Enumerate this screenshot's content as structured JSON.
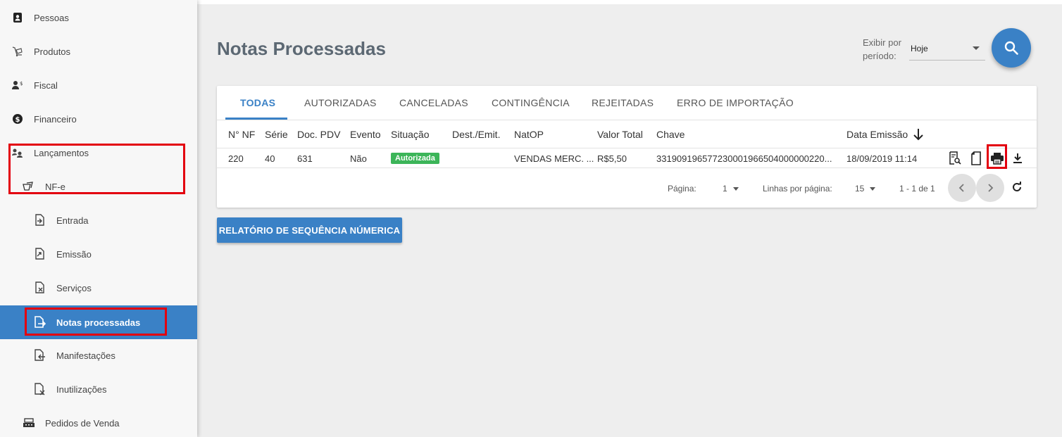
{
  "sidebar": {
    "items": [
      {
        "label": "Pessoas",
        "icon": "contacts-icon"
      },
      {
        "label": "Produtos",
        "icon": "products-icon"
      },
      {
        "label": "Fiscal",
        "icon": "fiscal-icon"
      },
      {
        "label": "Financeiro",
        "icon": "dollar-icon"
      },
      {
        "label": "Lançamentos",
        "icon": "launches-icon"
      },
      {
        "label": "NF-e",
        "icon": "nfe-icon"
      },
      {
        "label": "Entrada",
        "icon": "doc-in-icon"
      },
      {
        "label": "Emissão",
        "icon": "doc-out-icon"
      },
      {
        "label": "Serviços",
        "icon": "doc-service-icon"
      },
      {
        "label": "Notas processadas",
        "icon": "doc-export-icon"
      },
      {
        "label": "Manifestações",
        "icon": "doc-back-icon"
      },
      {
        "label": "Inutilizações",
        "icon": "doc-cancel-icon"
      },
      {
        "label": "Pedidos de Venda",
        "icon": "register-icon"
      }
    ],
    "active_color": "#3a81c6"
  },
  "header": {
    "title": "Notas Processadas",
    "period_label_line1": "Exibir por",
    "period_label_line2": "período:",
    "period_value": "Hoje"
  },
  "tabs": [
    "TODAS",
    "AUTORIZADAS",
    "CANCELADAS",
    "CONTINGÊNCIA",
    "REJEITADAS",
    "ERRO DE IMPORTAÇÃO"
  ],
  "table": {
    "columns": [
      "N° NF",
      "Série",
      "Doc. PDV",
      "Evento",
      "Situação",
      "Dest./Emit.",
      "NatOP",
      "Valor Total",
      "Chave",
      "Data Emissão"
    ],
    "rows": [
      {
        "nf": "220",
        "serie": "40",
        "doc_pdv": "631",
        "evento": "Não",
        "situacao": "Autorizada",
        "dest_emit": "",
        "natop": "VENDAS MERC. ...",
        "valor_total": "R$5,50",
        "chave": "331909196577230001966504000000220...",
        "data_emissao": "18/09/2019 11:14"
      }
    ]
  },
  "pagination": {
    "page_label": "Página:",
    "page_value": "1",
    "rows_label": "Linhas por página:",
    "rows_value": "15",
    "range": "1 - 1 de 1"
  },
  "report_button": "RELATÓRIO DE SEQUÊNCIA NÚMERICA",
  "colors": {
    "primary": "#3a81c6",
    "success": "#3cb559",
    "highlight": "#e3000f"
  }
}
